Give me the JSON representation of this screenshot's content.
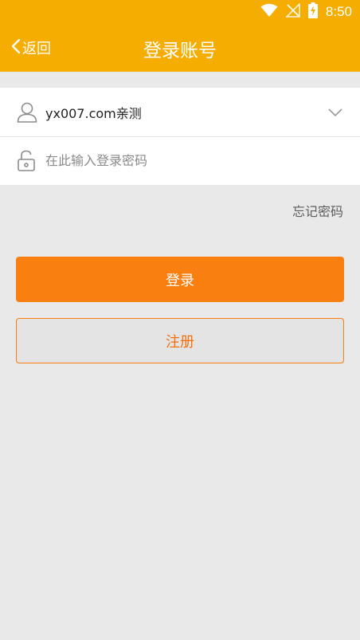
{
  "status_bar": {
    "time": "8:50",
    "icons": [
      "wifi-icon",
      "signal-off-icon",
      "battery-charging-icon"
    ]
  },
  "nav": {
    "back_label": "返回",
    "title": "登录账号"
  },
  "form": {
    "account_value": "yx007.com亲测",
    "password_placeholder": "在此输入登录密码",
    "password_value": ""
  },
  "links": {
    "forgot_password": "忘记密码"
  },
  "buttons": {
    "login": "登录",
    "register": "注册"
  },
  "colors": {
    "header": "#f6ad02",
    "primary": "#f87f10",
    "background": "#e9e9e9"
  }
}
